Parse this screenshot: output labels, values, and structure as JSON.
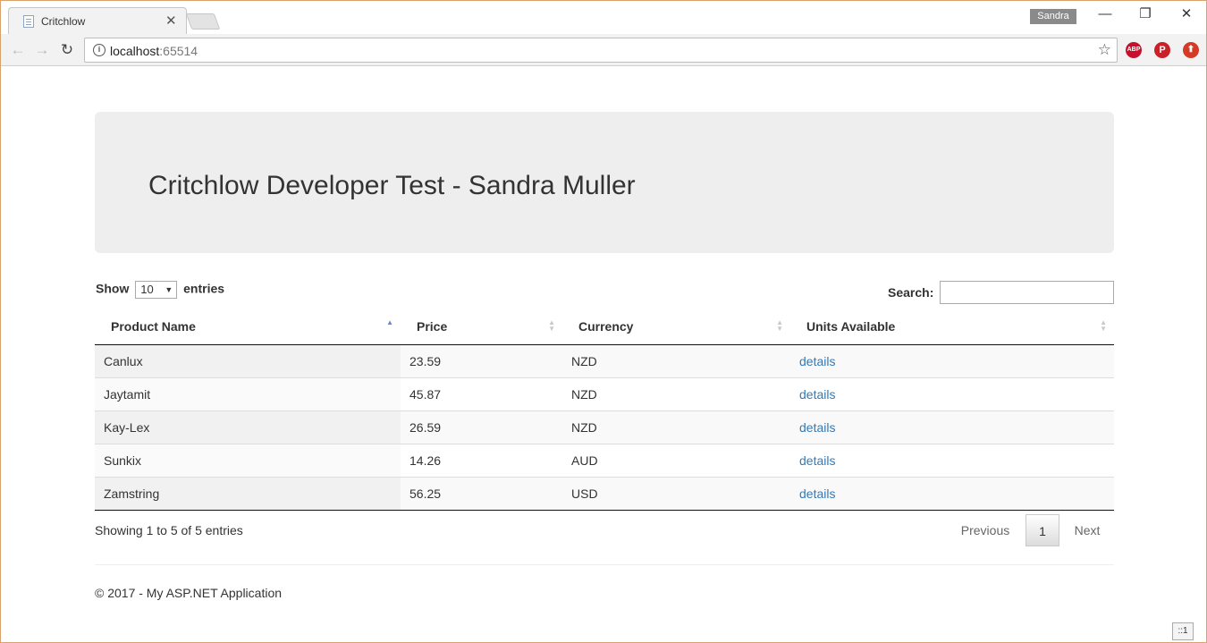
{
  "browser": {
    "tab_title": "Critchlow",
    "tab_close": "✕",
    "profile_name": "Sandra",
    "window_controls": {
      "minimize": "—",
      "restore": "❐",
      "close": "✕"
    },
    "nav": {
      "back": "←",
      "forward": "→",
      "reload": "↻"
    },
    "url_host": "localhost",
    "url_port": ":65514",
    "info": "i",
    "star": "☆",
    "extensions": [
      {
        "name": "ABP",
        "color": "#c8102e"
      },
      {
        "name": "P",
        "color": "#cb2027"
      },
      {
        "name": "⬆",
        "color": "#d43a25"
      }
    ]
  },
  "page": {
    "title": "Critchlow Developer Test - Sandra Muller",
    "length_label_before": "Show",
    "length_value": "10",
    "length_arrow": "▼",
    "length_label_after": "entries",
    "search_label": "Search:",
    "search_value": "",
    "columns": [
      "Product Name",
      "Price",
      "Currency",
      "Units Available"
    ],
    "rows": [
      {
        "name": "Canlux",
        "price": "23.59",
        "currency": "NZD",
        "units": "details"
      },
      {
        "name": "Jaytamit",
        "price": "45.87",
        "currency": "NZD",
        "units": "details"
      },
      {
        "name": "Kay-Lex",
        "price": "26.59",
        "currency": "NZD",
        "units": "details"
      },
      {
        "name": "Sunkix",
        "price": "14.26",
        "currency": "AUD",
        "units": "details"
      },
      {
        "name": "Zamstring",
        "price": "56.25",
        "currency": "USD",
        "units": "details"
      }
    ],
    "info": "Showing 1 to 5 of 5 entries",
    "pagination": {
      "previous": "Previous",
      "current": "1",
      "next": "Next"
    },
    "footer": "© 2017 - My ASP.NET Application",
    "corner_badge": "::1"
  }
}
